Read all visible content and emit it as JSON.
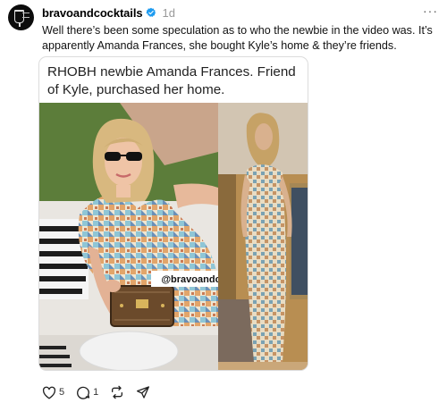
{
  "post": {
    "username": "bravoandcocktails",
    "timestamp": "1d",
    "more": "···",
    "caption": "Well there’s been some speculation as to who the newbie in the video was. It’s apparently Amanda Frances, she bought Kyle’s home & they’re friends."
  },
  "card": {
    "title": "RHOBH newbie Amanda Frances. Friend of Kyle, purchased her home.",
    "watermark": "@bravoandcocktails"
  },
  "actions": {
    "likes": "5",
    "replies": "1"
  },
  "colors": {
    "verified": "#1d9bf0",
    "text_muted": "#999999"
  }
}
